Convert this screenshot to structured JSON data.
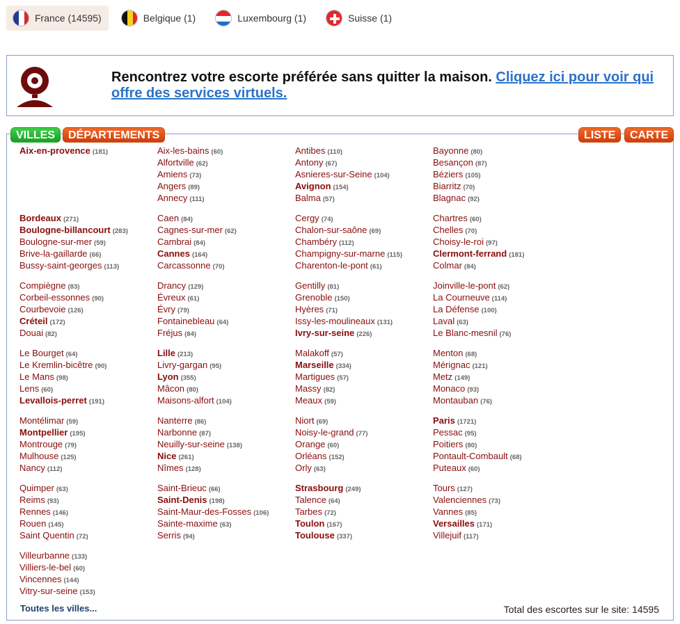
{
  "countries": [
    {
      "label": "France (14595)",
      "flag": "france-flag-icon",
      "active": true
    },
    {
      "label": "Belgique (1)",
      "flag": "belgium-flag-icon",
      "active": false
    },
    {
      "label": "Luxembourg (1)",
      "flag": "luxembourg-flag-icon",
      "active": false
    },
    {
      "label": "Suisse (1)",
      "flag": "switzerland-flag-icon",
      "active": false
    }
  ],
  "banner": {
    "icon": "webcam-icon",
    "text": "Rencontrez votre escorte préférée sans quitter la maison. ",
    "link": "Cliquez ici pour voir qui offre des services virtuels."
  },
  "tabs": {
    "villes": "VILLES",
    "departements": "DÉPARTEMENTS",
    "liste": "LISTE",
    "carte": "CARTE"
  },
  "colors": {
    "city": "#8a0d0d",
    "link": "#2a73c9",
    "green": "#1fa82a",
    "orange": "#e04e12"
  },
  "groups": [
    [
      [
        {
          "n": "Aix-en-provence",
          "c": "(181)",
          "b": true
        }
      ],
      [
        {
          "n": "Aix-les-bains",
          "c": "(60)"
        },
        {
          "n": "Alfortville",
          "c": "(62)"
        },
        {
          "n": "Amiens",
          "c": "(73)"
        },
        {
          "n": "Angers",
          "c": "(89)"
        },
        {
          "n": "Annecy",
          "c": "(111)"
        }
      ],
      [
        {
          "n": "Antibes",
          "c": "(110)"
        },
        {
          "n": "Antony",
          "c": "(67)"
        },
        {
          "n": "Asnieres-sur-Seine",
          "c": "(104)"
        },
        {
          "n": "Avignon",
          "c": "(154)",
          "b": true
        },
        {
          "n": "Balma",
          "c": "(57)"
        }
      ],
      [
        {
          "n": "Bayonne",
          "c": "(80)"
        },
        {
          "n": "Besançon",
          "c": "(87)"
        },
        {
          "n": "Béziers",
          "c": "(105)"
        },
        {
          "n": "Biarritz",
          "c": "(70)"
        },
        {
          "n": "Blagnac",
          "c": "(92)"
        }
      ]
    ],
    [
      [
        {
          "n": "Bordeaux",
          "c": "(271)",
          "b": true
        },
        {
          "n": "Boulogne-billancourt",
          "c": "(283)",
          "b": true
        },
        {
          "n": "Boulogne-sur-mer",
          "c": "(59)"
        },
        {
          "n": "Brive-la-gaillarde",
          "c": "(66)"
        },
        {
          "n": "Bussy-saint-georges",
          "c": "(113)"
        }
      ],
      [
        {
          "n": "Caen",
          "c": "(84)"
        },
        {
          "n": "Cagnes-sur-mer",
          "c": "(62)"
        },
        {
          "n": "Cambrai",
          "c": "(84)"
        },
        {
          "n": "Cannes",
          "c": "(164)",
          "b": true
        },
        {
          "n": "Carcassonne",
          "c": "(70)"
        }
      ],
      [
        {
          "n": "Cergy",
          "c": "(74)"
        },
        {
          "n": "Chalon-sur-saône",
          "c": "(69)"
        },
        {
          "n": "Chambéry",
          "c": "(112)"
        },
        {
          "n": "Champigny-sur-marne",
          "c": "(115)"
        },
        {
          "n": "Charenton-le-pont",
          "c": "(61)"
        }
      ],
      [
        {
          "n": "Chartres",
          "c": "(60)"
        },
        {
          "n": "Chelles",
          "c": "(70)"
        },
        {
          "n": "Choisy-le-roi",
          "c": "(97)"
        },
        {
          "n": "Clermont-ferrand",
          "c": "(181)",
          "b": true
        },
        {
          "n": "Colmar",
          "c": "(84)"
        }
      ]
    ],
    [
      [
        {
          "n": "Compiègne",
          "c": "(83)"
        },
        {
          "n": "Corbeil-essonnes",
          "c": "(90)"
        },
        {
          "n": "Courbevoie",
          "c": "(126)"
        },
        {
          "n": "Créteil",
          "c": "(172)",
          "b": true
        },
        {
          "n": "Douai",
          "c": "(82)"
        }
      ],
      [
        {
          "n": "Drancy",
          "c": "(129)"
        },
        {
          "n": "Évreux",
          "c": "(61)"
        },
        {
          "n": "Évry",
          "c": "(79)"
        },
        {
          "n": "Fontainebleau",
          "c": "(64)"
        },
        {
          "n": "Fréjus",
          "c": "(84)"
        }
      ],
      [
        {
          "n": "Gentilly",
          "c": "(81)"
        },
        {
          "n": "Grenoble",
          "c": "(150)"
        },
        {
          "n": "Hyères",
          "c": "(71)"
        },
        {
          "n": "Issy-les-moulineaux",
          "c": "(131)"
        },
        {
          "n": "Ivry-sur-seine",
          "c": "(226)",
          "b": true
        }
      ],
      [
        {
          "n": "Joinville-le-pont",
          "c": "(62)"
        },
        {
          "n": "La Courneuve",
          "c": "(114)"
        },
        {
          "n": "La Défense",
          "c": "(100)"
        },
        {
          "n": "Laval",
          "c": "(63)"
        },
        {
          "n": "Le Blanc-mesnil",
          "c": "(76)"
        }
      ]
    ],
    [
      [
        {
          "n": "Le Bourget",
          "c": "(64)"
        },
        {
          "n": "Le Kremlin-bicêtre",
          "c": "(90)"
        },
        {
          "n": "Le Mans",
          "c": "(98)"
        },
        {
          "n": "Lens",
          "c": "(60)"
        },
        {
          "n": "Levallois-perret",
          "c": "(191)",
          "b": true
        }
      ],
      [
        {
          "n": "Lille",
          "c": "(213)",
          "b": true
        },
        {
          "n": "Livry-gargan",
          "c": "(95)"
        },
        {
          "n": "Lyon",
          "c": "(355)",
          "b": true
        },
        {
          "n": "Mâcon",
          "c": "(80)"
        },
        {
          "n": "Maisons-alfort",
          "c": "(104)"
        }
      ],
      [
        {
          "n": "Malakoff",
          "c": "(57)"
        },
        {
          "n": "Marseille",
          "c": "(334)",
          "b": true
        },
        {
          "n": "Martigues",
          "c": "(57)"
        },
        {
          "n": "Massy",
          "c": "(82)"
        },
        {
          "n": "Meaux",
          "c": "(59)"
        }
      ],
      [
        {
          "n": "Menton",
          "c": "(68)"
        },
        {
          "n": "Mérignac",
          "c": "(121)"
        },
        {
          "n": "Metz",
          "c": "(149)"
        },
        {
          "n": "Monaco",
          "c": "(93)"
        },
        {
          "n": "Montauban",
          "c": "(76)"
        }
      ]
    ],
    [
      [
        {
          "n": "Montélimar",
          "c": "(59)"
        },
        {
          "n": "Montpellier",
          "c": "(195)",
          "b": true
        },
        {
          "n": "Montrouge",
          "c": "(79)"
        },
        {
          "n": "Mulhouse",
          "c": "(125)"
        },
        {
          "n": "Nancy",
          "c": "(112)"
        }
      ],
      [
        {
          "n": "Nanterre",
          "c": "(86)"
        },
        {
          "n": "Narbonne",
          "c": "(87)"
        },
        {
          "n": "Neuilly-sur-seine",
          "c": "(138)"
        },
        {
          "n": "Nice",
          "c": "(261)",
          "b": true
        },
        {
          "n": "Nîmes",
          "c": "(128)"
        }
      ],
      [
        {
          "n": "Niort",
          "c": "(69)"
        },
        {
          "n": "Noisy-le-grand",
          "c": "(77)"
        },
        {
          "n": "Orange",
          "c": "(60)"
        },
        {
          "n": "Orléans",
          "c": "(152)"
        },
        {
          "n": "Orly",
          "c": "(63)"
        }
      ],
      [
        {
          "n": "Paris",
          "c": "(1721)",
          "b": true
        },
        {
          "n": "Pessac",
          "c": "(95)"
        },
        {
          "n": "Poitiers",
          "c": "(80)"
        },
        {
          "n": "Pontault-Combault",
          "c": "(68)"
        },
        {
          "n": "Puteaux",
          "c": "(60)"
        }
      ]
    ],
    [
      [
        {
          "n": "Quimper",
          "c": "(63)"
        },
        {
          "n": "Reims",
          "c": "(93)"
        },
        {
          "n": "Rennes",
          "c": "(146)"
        },
        {
          "n": "Rouen",
          "c": "(145)"
        },
        {
          "n": "Saint Quentin",
          "c": "(72)"
        }
      ],
      [
        {
          "n": "Saint-Brieuc",
          "c": "(66)"
        },
        {
          "n": "Saint-Denis",
          "c": "(198)",
          "b": true
        },
        {
          "n": "Saint-Maur-des-Fosses",
          "c": "(106)"
        },
        {
          "n": "Sainte-maxime",
          "c": "(63)"
        },
        {
          "n": "Serris",
          "c": "(94)"
        }
      ],
      [
        {
          "n": "Strasbourg",
          "c": "(249)",
          "b": true
        },
        {
          "n": "Talence",
          "c": "(64)"
        },
        {
          "n": "Tarbes",
          "c": "(72)"
        },
        {
          "n": "Toulon",
          "c": "(167)",
          "b": true
        },
        {
          "n": "Toulouse",
          "c": "(337)",
          "b": true
        }
      ],
      [
        {
          "n": "Tours",
          "c": "(127)"
        },
        {
          "n": "Valenciennes",
          "c": "(73)"
        },
        {
          "n": "Vannes",
          "c": "(85)"
        },
        {
          "n": "Versailles",
          "c": "(171)",
          "b": true
        },
        {
          "n": "Villejuif",
          "c": "(117)"
        }
      ]
    ],
    [
      [
        {
          "n": "Villeurbanne",
          "c": "(133)"
        },
        {
          "n": "Villiers-le-bel",
          "c": "(60)"
        },
        {
          "n": "Vincennes",
          "c": "(144)"
        },
        {
          "n": "Vitry-sur-seine",
          "c": "(153)"
        }
      ]
    ]
  ],
  "footer": {
    "all_cities": "Toutes les villes...",
    "total": "Total des escortes sur le site: 14595"
  }
}
